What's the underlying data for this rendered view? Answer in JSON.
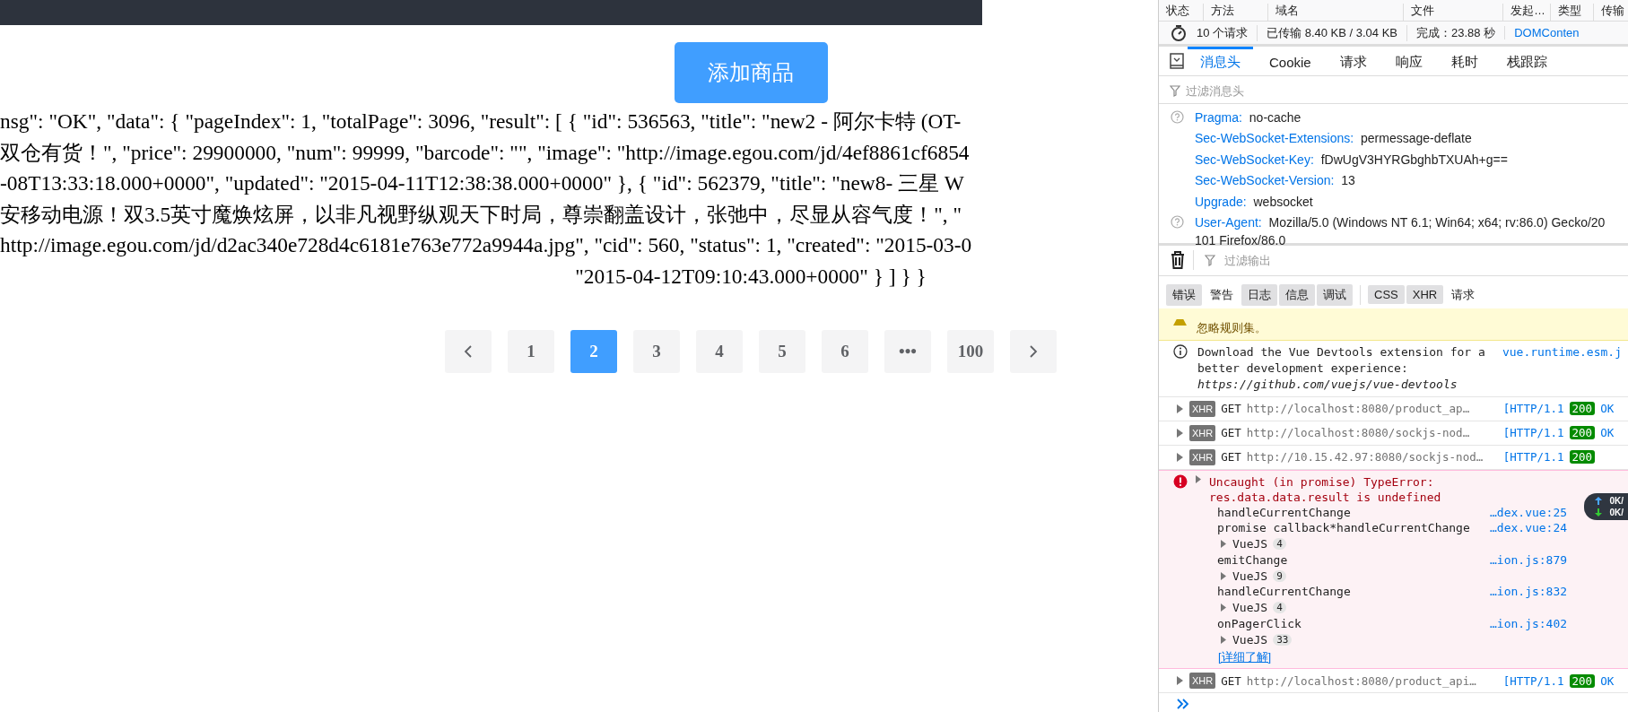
{
  "add_button": "添加商品",
  "response_lines": [
    "nsg\": \"OK\", \"data\": { \"pageIndex\": 1, \"totalPage\": 3096, \"result\": [ { \"id\": 536563, \"title\": \"new2 - 阿尔卡特 (OT-",
    "双仓有货！\", \"price\": 29900000, \"num\": 99999, \"barcode\": \"\", \"image\": \"http://image.egou.com/jd/4ef8861cf6854",
    "-08T13:33:18.000+0000\", \"updated\": \"2015-04-11T12:38:38.000+0000\" }, { \"id\": 562379, \"title\": \"new8- 三星 W",
    "安移动电源！双3.5英寸魔焕炫屏，以非凡视野纵观天下时局，尊崇翻盖设计，张弛中，尽显从容气度！\", \"",
    "http://image.egou.com/jd/d2ac340e728d4c6181e763e772a9944a.jpg\", \"cid\": 560, \"status\": 1, \"created\": \"2015-03-0",
    "\"2015-04-12T09:10:43.000+0000\" } ] } }"
  ],
  "pagination": [
    {
      "kind": "prev",
      "selected": false
    },
    {
      "kind": "page",
      "label": "1",
      "selected": false
    },
    {
      "kind": "page",
      "label": "2",
      "selected": true
    },
    {
      "kind": "page",
      "label": "3",
      "selected": false
    },
    {
      "kind": "page",
      "label": "4",
      "selected": false
    },
    {
      "kind": "page",
      "label": "5",
      "selected": false
    },
    {
      "kind": "page",
      "label": "6",
      "selected": false
    },
    {
      "kind": "page",
      "label": "•••",
      "selected": false
    },
    {
      "kind": "page",
      "label": "100",
      "selected": false
    },
    {
      "kind": "next",
      "selected": false
    }
  ],
  "devtools": {
    "network_columns": [
      "状态",
      "方法",
      "域名",
      "文件",
      "发起…",
      "类型",
      "传输"
    ],
    "summary": {
      "requests": "10 个请求",
      "transferred": "已传输 8.40 KB / 3.04 KB",
      "finished": "完成：23.88 秒",
      "dom_content": "DOMConten"
    },
    "detail_tabs": [
      {
        "label": "消息头",
        "selected": true
      },
      {
        "label": "Cookie",
        "selected": false
      },
      {
        "label": "请求",
        "selected": false
      },
      {
        "label": "响应",
        "selected": false
      },
      {
        "label": "耗时",
        "selected": false
      },
      {
        "label": "栈跟踪",
        "selected": false
      }
    ],
    "header_filter": {
      "placeholder": "过滤消息头"
    },
    "headers": [
      {
        "name": "Pragma:",
        "value": "no-cache",
        "help": true
      },
      {
        "name": "Sec-WebSocket-Extensions:",
        "value": "permessage-deflate",
        "help": false
      },
      {
        "name": "Sec-WebSocket-Key:",
        "value": "fDwUgV3HYRGbghbTXUAh+g==",
        "help": false
      },
      {
        "name": "Sec-WebSocket-Version:",
        "value": "13",
        "help": false
      },
      {
        "name": "Upgrade:",
        "value": "websocket",
        "help": false
      },
      {
        "name": "User-Agent:",
        "value": "Mozilla/5.0 (Windows NT 6.1; Win64; x64; rv:86.0) Gecko/20",
        "value_continued": "101 Firefox/86.0",
        "help": true
      }
    ],
    "console_filter": {
      "placeholder": "过滤输出"
    },
    "level_buttons": [
      {
        "label": "错误",
        "selected": true
      },
      {
        "label": "警告",
        "selected": false
      },
      {
        "label": "日志",
        "selected": true
      },
      {
        "label": "信息",
        "selected": true
      },
      {
        "label": "调试",
        "selected": true
      }
    ],
    "type_buttons": [
      {
        "label": "CSS",
        "selected": true
      },
      {
        "label": "XHR",
        "selected": true
      },
      {
        "label": "请求",
        "selected": false
      }
    ],
    "messages": [
      {
        "kind": "warning",
        "text": "忽略规则集。"
      },
      {
        "kind": "info",
        "text": "Download the Vue Devtools extension for a better development experience:",
        "link": "https://github.com/vuejs/vue-devtools",
        "source": "vue.runtime.esm.j"
      },
      {
        "kind": "xhr",
        "badge": "XHR",
        "method": "GET",
        "url": "http://localhost:8080/product_ap…",
        "protocol": "[HTTP/1.1",
        "status": "200",
        "status_text": "OK"
      },
      {
        "kind": "xhr",
        "badge": "XHR",
        "method": "GET",
        "url": "http://localhost:8080/sockjs-nod…",
        "protocol": "[HTTP/1.1",
        "status": "200",
        "status_text": "OK"
      },
      {
        "kind": "xhr",
        "badge": "XHR",
        "method": "GET",
        "url": "http://10.15.42.97:8080/sockjs-nod…",
        "protocol": "[HTTP/1.1",
        "status": "200"
      },
      {
        "kind": "error",
        "text": "Uncaught (in promise) TypeError: res.data.data.result is undefined",
        "stack": [
          {
            "kind": "frame",
            "function": "handleCurrentChange",
            "source": "…dex.vue:25"
          },
          {
            "kind": "frame",
            "function": "promise callback*handleCurrentChange",
            "source": "…dex.vue:24"
          },
          {
            "kind": "group",
            "label": "VueJS",
            "count": "4"
          },
          {
            "kind": "frame",
            "function": "emitChange",
            "source": "…ion.js:879"
          },
          {
            "kind": "group",
            "label": "VueJS",
            "count": "9"
          },
          {
            "kind": "frame",
            "function": "handleCurrentChange",
            "source": "…ion.js:832"
          },
          {
            "kind": "group",
            "label": "VueJS",
            "count": "4"
          },
          {
            "kind": "frame",
            "function": "onPagerClick",
            "source": "…ion.js:402"
          },
          {
            "kind": "group",
            "label": "VueJS",
            "count": "33"
          }
        ],
        "link": "[详细了解]"
      },
      {
        "kind": "xhr",
        "badge": "XHR",
        "method": "GET",
        "url": "http://localhost:8080/product_api…",
        "protocol": "[HTTP/1.1",
        "status": "200",
        "status_text": "OK"
      }
    ],
    "network_speed": {
      "up": "0K/",
      "down": "0K/"
    }
  }
}
